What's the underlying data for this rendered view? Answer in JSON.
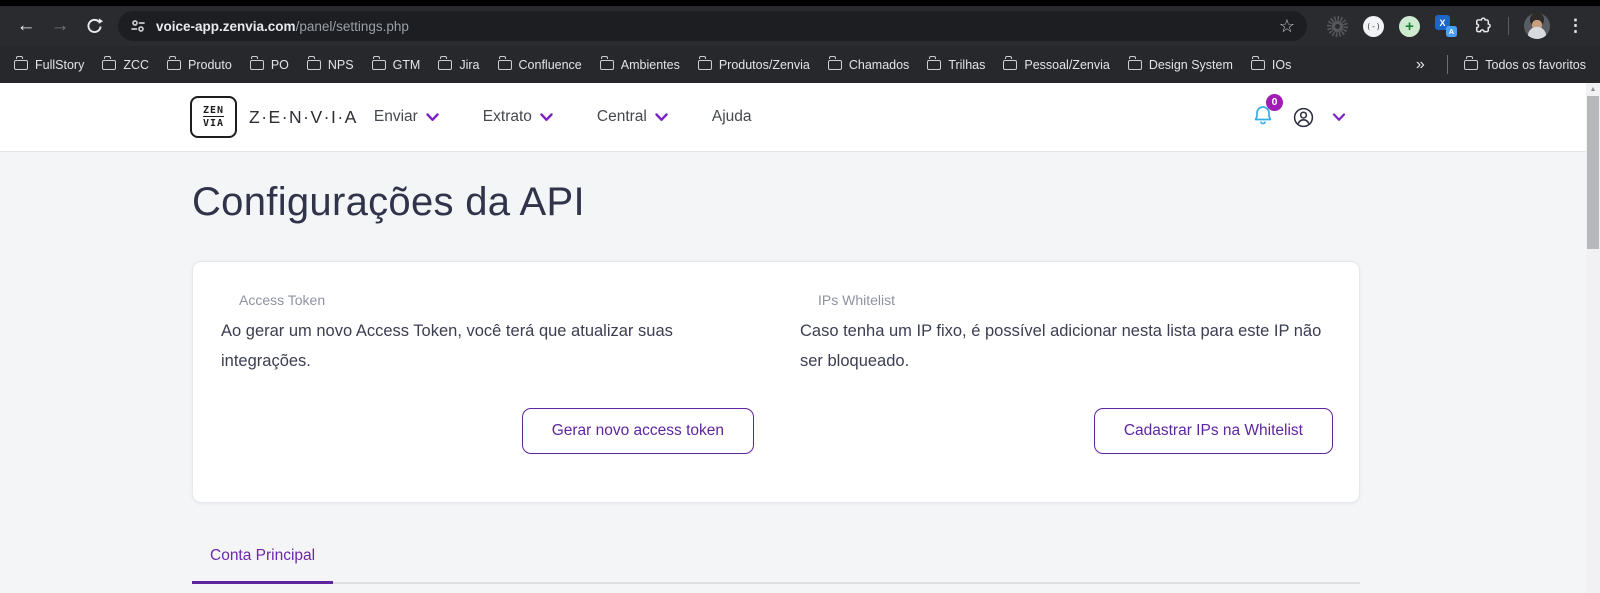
{
  "browser": {
    "url": {
      "domain": "voice-app.zenvia.com",
      "path": "/panel/settings.php"
    },
    "bookmarks": [
      "FullStory",
      "ZCC",
      "Produto",
      "PO",
      "NPS",
      "GTM",
      "Jira",
      "Confluence",
      "Ambientes",
      "Produtos/Zenvia",
      "Chamados",
      "Trilhas",
      "Pessoal/Zenvia",
      "Design System",
      "IOs"
    ],
    "all_favorites_label": "Todos os favoritos",
    "icons": {
      "back": "←",
      "forward": "→",
      "bookmark_star": "☆",
      "menu_dots": "⋮",
      "overflow_chevron": "»",
      "translate_main": "X",
      "translate_sub": "A",
      "circle_ext": "(-)",
      "green_plus": "+",
      "scroll_up": "▲"
    }
  },
  "header": {
    "logo": {
      "top": "ZEN",
      "bottom": "VIA",
      "wordmark": "Z·E·N·V·I·A"
    },
    "nav": [
      {
        "label": "Enviar",
        "dropdown": true
      },
      {
        "label": "Extrato",
        "dropdown": true
      },
      {
        "label": "Central",
        "dropdown": true
      },
      {
        "label": "Ajuda",
        "dropdown": false
      }
    ],
    "notifications_badge": "0"
  },
  "page": {
    "title": "Configurações da API",
    "card": {
      "sections": [
        {
          "label": "Access Token",
          "description": "Ao gerar um novo Access Token, você terá que atualizar suas integrações.",
          "button_label": "Gerar novo access token"
        },
        {
          "label": "IPs Whitelist",
          "description": "Caso tenha um IP fixo, é possível adicionar nesta lista para este IP não ser bloqueado.",
          "button_label": "Cadastrar IPs na Whitelist"
        }
      ]
    },
    "tabs": [
      {
        "label": "Conta Principal",
        "active": true
      }
    ]
  },
  "colors": {
    "accent_purple": "#5f259f",
    "tab_active_purple": "#6d28a9",
    "nav_chevron_purple": "#7a22c9",
    "bell_blue": "#35aee3",
    "badge_magenta": "#a11bb5",
    "chrome_toolbar": "#2a2b2e",
    "page_background": "#f4f5f7"
  }
}
